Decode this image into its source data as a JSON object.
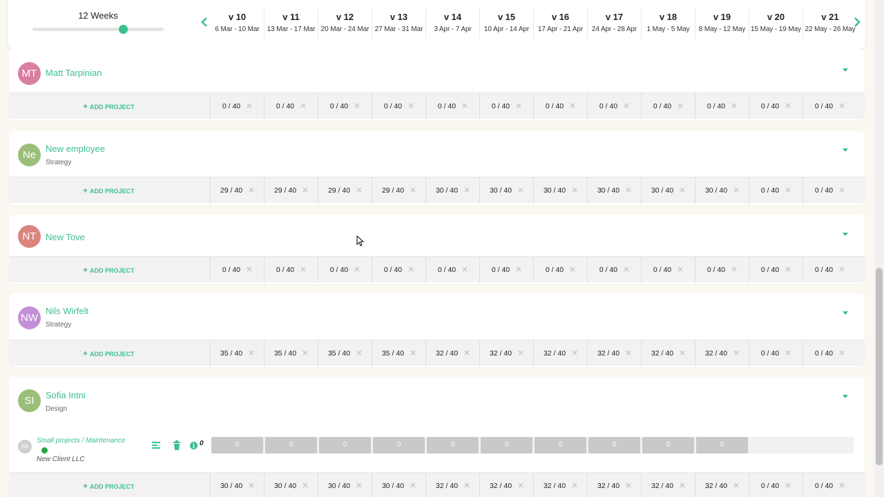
{
  "header": {
    "zoom_label": "12 Weeks",
    "zoom_level": 0.69,
    "prev_icon": "chevron-left-icon",
    "next_icon": "chevron-right-icon",
    "weeks": [
      {
        "num": "v 10",
        "range": "6 Mar - 10 Mar"
      },
      {
        "num": "v 11",
        "range": "13 Mar - 17 Mar"
      },
      {
        "num": "v 12",
        "range": "20 Mar - 24 Mar"
      },
      {
        "num": "v 13",
        "range": "27 Mar - 31 Mar"
      },
      {
        "num": "v 14",
        "range": "3 Apr - 7 Apr"
      },
      {
        "num": "v 15",
        "range": "10 Apr - 14 Apr"
      },
      {
        "num": "v 16",
        "range": "17 Apr - 21 Apr"
      },
      {
        "num": "v 17",
        "range": "24 Apr - 28 Apr"
      },
      {
        "num": "v 18",
        "range": "1 May - 5 May"
      },
      {
        "num": "v 19",
        "range": "8 May - 12 May"
      },
      {
        "num": "v 20",
        "range": "15 May - 19 May"
      },
      {
        "num": "v 21",
        "range": "22 May - 26 May"
      }
    ]
  },
  "add_project_label": "ADD PROJECT",
  "people": [
    {
      "initials": "MT",
      "name": "Matt Tarpinian",
      "role": "",
      "avatar_color": "#d97fa1",
      "hours": [
        "0 / 40",
        "0 / 40",
        "0 / 40",
        "0 / 40",
        "0 / 40",
        "0 / 40",
        "0 / 40",
        "0 / 40",
        "0 / 40",
        "0 / 40",
        "0 / 40",
        "0 / 40"
      ]
    },
    {
      "initials": "Ne",
      "name": "New employee",
      "role": "Strategy",
      "avatar_color": "#9bbf7a",
      "hours": [
        "29 / 40",
        "29 / 40",
        "29 / 40",
        "29 / 40",
        "30 / 40",
        "30 / 40",
        "30 / 40",
        "30 / 40",
        "30 / 40",
        "30 / 40",
        "0 / 40",
        "0 / 40"
      ]
    },
    {
      "initials": "NT",
      "name": "New Tove",
      "role": "",
      "avatar_color": "#d9857e",
      "hours": [
        "0 / 40",
        "0 / 40",
        "0 / 40",
        "0 / 40",
        "0 / 40",
        "0 / 40",
        "0 / 40",
        "0 / 40",
        "0 / 40",
        "0 / 40",
        "0 / 40",
        "0 / 40"
      ]
    },
    {
      "initials": "NW",
      "name": "Nils Wirfelt",
      "role": "Strategy",
      "avatar_color": "#c38fd6",
      "hours": [
        "35 / 40",
        "35 / 40",
        "35 / 40",
        "35 / 40",
        "32 / 40",
        "32 / 40",
        "32 / 40",
        "32 / 40",
        "32 / 40",
        "32 / 40",
        "0 / 40",
        "0 / 40"
      ]
    },
    {
      "initials": "SI",
      "name": "Sofia Intni",
      "role": "Design",
      "avatar_color": "#9bbf7a",
      "hours": [
        "30 / 40",
        "30 / 40",
        "30 / 40",
        "30 / 40",
        "32 / 40",
        "32 / 40",
        "32 / 40",
        "32 / 40",
        "32 / 40",
        "32 / 40",
        "0 / 40",
        "0 / 40"
      ],
      "project": {
        "initials": "Ne",
        "name": "Small projects / Maintenance",
        "client": "New Client LLC",
        "total": "0",
        "status_color": "#23a445",
        "allocations": [
          "0",
          "0",
          "0",
          "0",
          "0",
          "0",
          "0",
          "0",
          "0",
          "0"
        ]
      }
    }
  ],
  "icons": {
    "remove": "close-icon",
    "list": "list-icon",
    "trash": "trash-icon",
    "info": "info-icon",
    "add": "plus-icon",
    "caret": "caret-down-icon"
  }
}
